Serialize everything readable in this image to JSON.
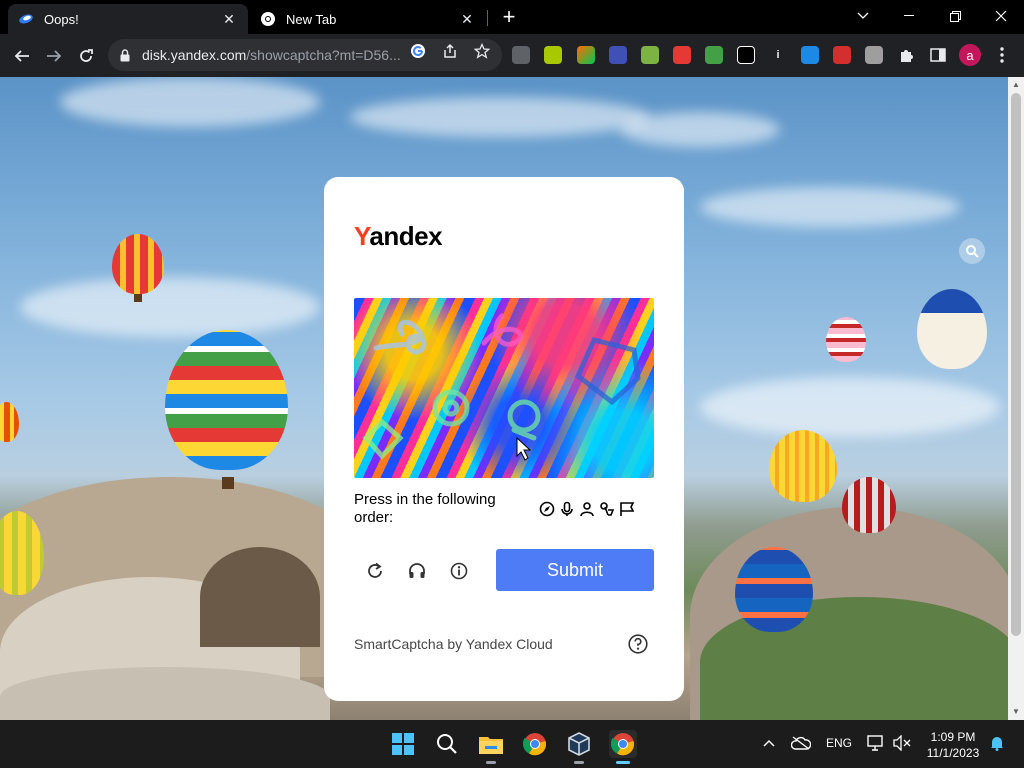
{
  "browser": {
    "tabs": [
      {
        "title": "Oops!",
        "active": true,
        "favicon": "yandex-disk-icon"
      },
      {
        "title": "New Tab",
        "active": false,
        "favicon": "chrome-icon"
      }
    ],
    "url_host": "disk.yandex.com",
    "url_path": "/showcaptcha?mt=D56...",
    "profile_initial": "a",
    "extensions": [
      "extension-1",
      "extension-2",
      "extension-3",
      "extension-4",
      "extension-5",
      "extension-6",
      "extension-7",
      "extension-8",
      "extension-9",
      "extension-10",
      "extension-11",
      "extension-12"
    ]
  },
  "captcha": {
    "logo": "Yandex",
    "logo_first": "Y",
    "logo_rest": "andex",
    "instruction": "Press in the following order:",
    "order_icons": [
      "compass-icon",
      "microphone-icon",
      "person-icon",
      "tap-icon",
      "flag-icon"
    ],
    "submit_label": "Submit",
    "footer": "SmartCaptcha by Yandex Cloud",
    "brand_color": "#fc3f1d",
    "submit_color": "#4e7cf6"
  },
  "taskbar": {
    "apps": [
      "windows-start",
      "search",
      "file-explorer",
      "chrome",
      "virtualbox",
      "chrome-active"
    ],
    "tray_lang": "ENG",
    "time": "1:09 PM",
    "date": "11/1/2023"
  }
}
